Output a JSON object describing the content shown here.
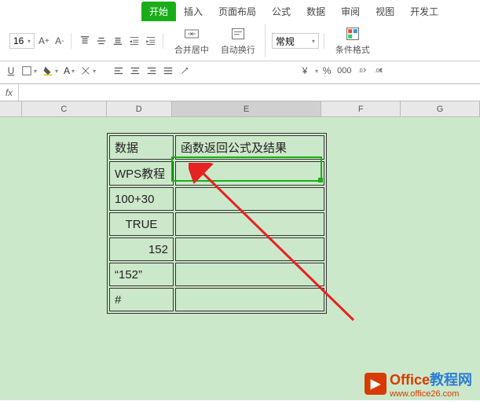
{
  "tabs": {
    "start": "开始",
    "insert": "插入",
    "layout": "页面布局",
    "formula": "公式",
    "data": "数据",
    "review": "审阅",
    "view": "视图",
    "dev": "开发工"
  },
  "toolbar": {
    "font_size": "16",
    "merge_label": "合并居中",
    "wrap_label": "自动换行",
    "number_format": "常规",
    "cond_format": "条件格式"
  },
  "formula_bar": {
    "fx": "fx"
  },
  "columns": {
    "c": "C",
    "d": "D",
    "e": "E",
    "f": "F",
    "g": "G"
  },
  "table": {
    "header_d": "数据",
    "header_e": "函数返回公式及结果",
    "rows": [
      {
        "d": "WPS教程",
        "e": ""
      },
      {
        "d": "100+30",
        "e": ""
      },
      {
        "d": "TRUE",
        "e": ""
      },
      {
        "d": "152",
        "e": ""
      },
      {
        "d": "“152”",
        "e": ""
      },
      {
        "d": "#",
        "e": ""
      }
    ]
  },
  "watermark": {
    "brand1": "Office",
    "brand2": "教程网",
    "url": "www.office26.com"
  },
  "icons": {
    "currency": "¥",
    "percent": "%",
    "thousand": "000"
  }
}
